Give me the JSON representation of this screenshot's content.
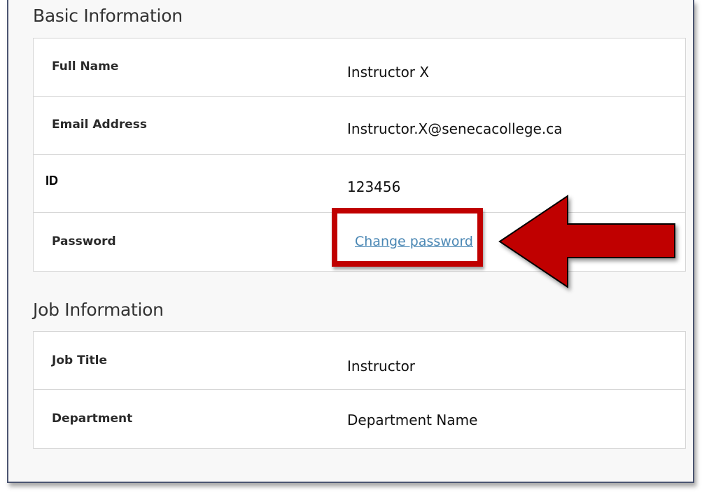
{
  "basic_information": {
    "title": "Basic Information",
    "rows": [
      {
        "label": "Full Name",
        "value": "Instructor X"
      },
      {
        "label": "Email Address",
        "value": "Instructor.X@senecacollege.ca"
      },
      {
        "label": "ID",
        "value": "123456"
      },
      {
        "label": "Password",
        "value": "Change password"
      }
    ]
  },
  "job_information": {
    "title": "Job Information",
    "rows": [
      {
        "label": "Job Title",
        "value": "Instructor"
      },
      {
        "label": "Department",
        "value": "Department Name"
      }
    ]
  },
  "colors": {
    "highlight": "#c00000",
    "link": "#4a87b4",
    "frame_border": "#4a5470"
  }
}
